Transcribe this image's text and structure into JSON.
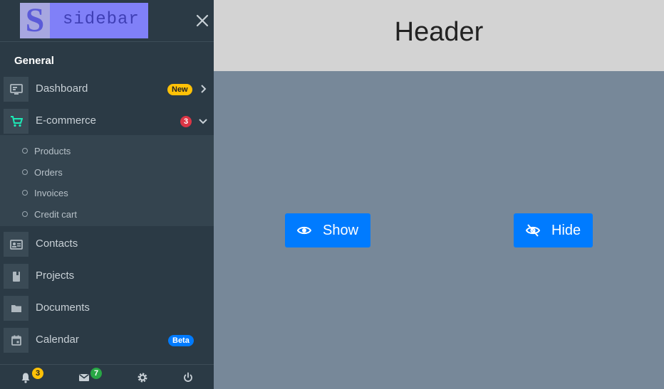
{
  "sidebar": {
    "brand": {
      "letter": "S",
      "text": "sidebar"
    },
    "section_title": "General",
    "items": [
      {
        "label": "Dashboard",
        "icon": "monitor-icon",
        "badge": "New"
      },
      {
        "label": "E-commerce",
        "icon": "cart-icon",
        "badge": "3"
      },
      {
        "label": "Contacts",
        "icon": "contact-card-icon"
      },
      {
        "label": "Projects",
        "icon": "book-icon"
      },
      {
        "label": "Documents",
        "icon": "folder-icon"
      },
      {
        "label": "Calendar",
        "icon": "calendar-icon",
        "badge": "Beta"
      }
    ],
    "submenu": [
      "Products",
      "Orders",
      "Invoices",
      "Credit cart"
    ],
    "footer": {
      "notifications_count": "3",
      "messages_count": "7"
    }
  },
  "header": {
    "title": "Header"
  },
  "main": {
    "show_label": "Show",
    "hide_label": "Hide"
  },
  "colors": {
    "sidebar_bg": "#2b3a45",
    "accent": "#007bff",
    "cart_icon": "#1de9b6",
    "content_bg": "#778899",
    "header_bg": "#d3d3d3"
  }
}
